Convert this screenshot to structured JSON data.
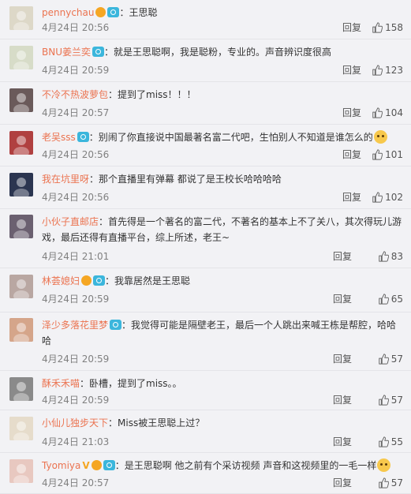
{
  "reply_label": "回复",
  "comments": [
    {
      "user": "pennychau",
      "badges": [
        "vip",
        "cam"
      ],
      "sep": "：",
      "text": "王思聪",
      "time": "4月24日 20:56",
      "likes": "158",
      "emoji": false
    },
    {
      "user": "BNU姜兰奕",
      "badges": [
        "cam"
      ],
      "sep": "：",
      "text": "就是王思聪啊，我是聪粉，专业的。声音辨识度很高",
      "time": "4月24日 20:59",
      "likes": "123",
      "emoji": false
    },
    {
      "user": "不冷不热波萝包",
      "badges": [],
      "sep": "：",
      "text": "提到了miss！！！",
      "time": "4月24日 20:57",
      "likes": "104",
      "emoji": false
    },
    {
      "user": "老吴sss",
      "badges": [
        "cam"
      ],
      "sep": "：",
      "text": "别闹了你直接说中国最著名富二代吧，生怕别人不知道是谁怎么的",
      "time": "4月24日 20:56",
      "likes": "101",
      "emoji": true
    },
    {
      "user": "我在坑里呀",
      "badges": [],
      "sep": "：",
      "text": "那个直播里有弹幕 都说了是王校长哈哈哈哈",
      "time": "4月24日 20:56",
      "likes": "102",
      "emoji": false
    },
    {
      "user": "小伙子直邮店",
      "badges": [],
      "sep": "：",
      "text": "首先得是一个著名的富二代，不著名的基本上不了关八，其次得玩儿游戏，最后还得有直播平台，综上所述，老王~",
      "time": "4月24日 21:01",
      "likes": "83",
      "emoji": false
    },
    {
      "user": "林荟媳妇",
      "badges": [
        "vip",
        "cam"
      ],
      "sep": "：",
      "text": "我靠居然是王思聪",
      "time": "4月24日 20:59",
      "likes": "65",
      "emoji": false
    },
    {
      "user": "泽少多落花里梦",
      "badges": [
        "cam"
      ],
      "sep": "：",
      "text": "我觉得可能是隔壁老王，最后一个人跳出来喊王栋是帮腔，哈哈哈",
      "time": "4月24日 20:59",
      "likes": "57",
      "emoji": false
    },
    {
      "user": "酥禾禾喵",
      "badges": [],
      "sep": "：",
      "text": "卧槽，提到了miss。。",
      "time": "4月24日 20:59",
      "likes": "57",
      "emoji": false
    },
    {
      "user": "小仙儿独步天下",
      "badges": [],
      "sep": "：",
      "text": "Miss被王思聪上过？",
      "time": "4月24日 21:03",
      "likes": "55",
      "emoji": false
    },
    {
      "user": "Tyomiya",
      "badges": [
        "vv",
        "vip",
        "cam"
      ],
      "sep": "：",
      "text": "是王思聪啊 他之前有个采访视频 声音和这视频里的一毛一样",
      "time": "4月24日 20:57",
      "likes": "57",
      "emoji": true
    }
  ]
}
